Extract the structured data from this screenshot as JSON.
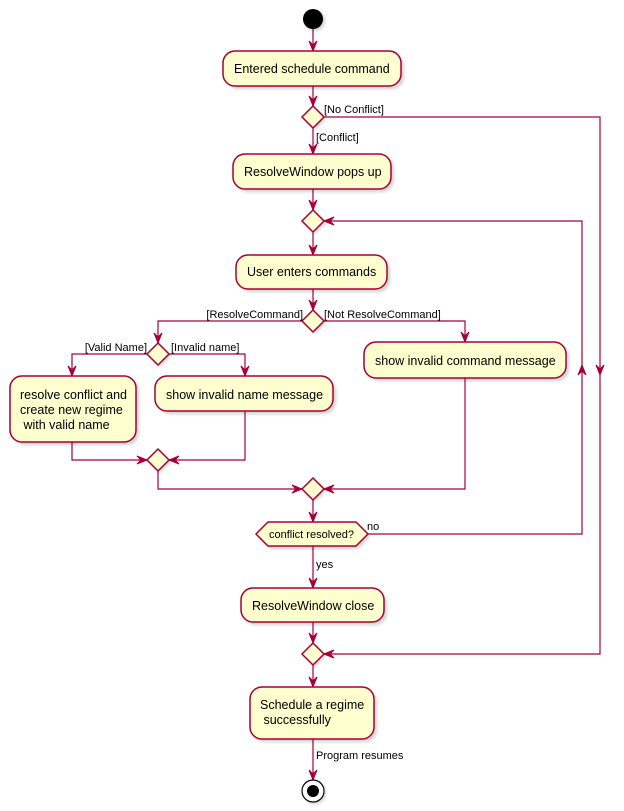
{
  "diagram": {
    "type": "activity",
    "colors": {
      "node_fill": "#FEFECE",
      "stroke": "#A80036",
      "start_fill": "#000000"
    },
    "nodes": {
      "entered": {
        "lines": [
          "Entered schedule command"
        ]
      },
      "popup": {
        "lines": [
          "ResolveWindow pops up"
        ]
      },
      "user_enters": {
        "lines": [
          "User enters commands"
        ]
      },
      "resolve_conflict": {
        "lines": [
          "resolve conflict and",
          "create new regime",
          " with valid name"
        ]
      },
      "invalid_name": {
        "lines": [
          "show invalid name message"
        ]
      },
      "invalid_command": {
        "lines": [
          "show invalid command message"
        ]
      },
      "conflict_check": {
        "lines": [
          "conflict resolved?"
        ]
      },
      "close": {
        "lines": [
          "ResolveWindow close"
        ]
      },
      "success": {
        "lines": [
          "Schedule a regime",
          " successfully"
        ]
      }
    },
    "edge_labels": {
      "no_conflict": "[No Conflict]",
      "conflict": "[Conflict]",
      "resolve_command": "[ResolveCommand]",
      "not_resolve_command": "[Not ResolveCommand]",
      "valid_name": "[Valid Name]",
      "invalid_name": "[Invalid name]",
      "no": "no",
      "yes": "yes",
      "program_resumes": "Program resumes"
    }
  }
}
